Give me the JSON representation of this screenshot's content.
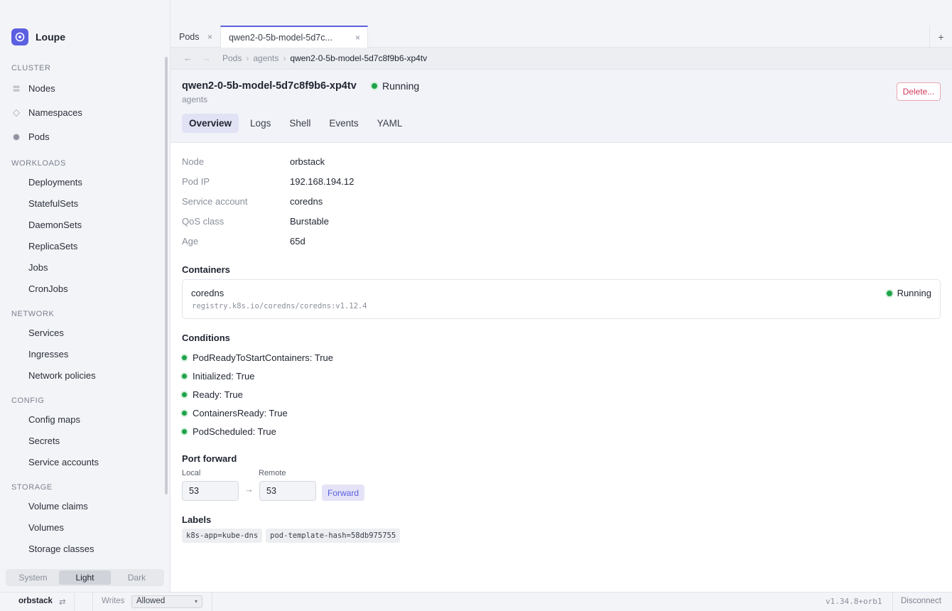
{
  "app": {
    "name": "Loupe",
    "accent": "#5b5fe0"
  },
  "nav": {
    "sections": [
      {
        "title": "CLUSTER",
        "items": [
          {
            "label": "Nodes",
            "icon": "server-icon"
          },
          {
            "label": "Namespaces",
            "icon": "diamond-icon"
          },
          {
            "label": "Pods",
            "icon": "circle-icon"
          }
        ]
      },
      {
        "title": "WORKLOADS",
        "items": [
          {
            "label": "Deployments"
          },
          {
            "label": "StatefulSets"
          },
          {
            "label": "DaemonSets"
          },
          {
            "label": "ReplicaSets"
          },
          {
            "label": "Jobs"
          },
          {
            "label": "CronJobs"
          }
        ]
      },
      {
        "title": "NETWORK",
        "items": [
          {
            "label": "Services"
          },
          {
            "label": "Ingresses"
          },
          {
            "label": "Network policies"
          }
        ]
      },
      {
        "title": "CONFIG",
        "items": [
          {
            "label": "Config maps"
          },
          {
            "label": "Secrets"
          },
          {
            "label": "Service accounts"
          }
        ]
      },
      {
        "title": "STORAGE",
        "items": [
          {
            "label": "Volume claims"
          },
          {
            "label": "Volumes"
          },
          {
            "label": "Storage classes"
          }
        ]
      }
    ]
  },
  "theme": {
    "options": [
      "System",
      "Light",
      "Dark"
    ],
    "selected": "Light"
  },
  "tabs": [
    {
      "label": "Pods",
      "active": false
    },
    {
      "label": "qwen2-0-5b-model-5d7c...",
      "active": true
    }
  ],
  "add_tab_label": "+",
  "breadcrumb": {
    "items": [
      "Pods",
      "agents"
    ],
    "current": "qwen2-0-5b-model-5d7c8f9b6-xp4tv"
  },
  "pod": {
    "name": "qwen2-0-5b-model-5d7c8f9b6-xp4tv",
    "status": "Running",
    "namespace": "agents",
    "status_color": "#1fa34a"
  },
  "delete_label": "Delete...",
  "subtabs": [
    "Overview",
    "Logs",
    "Shell",
    "Events",
    "YAML"
  ],
  "active_subtab": "Overview",
  "details": [
    {
      "key": "Node",
      "value": "orbstack"
    },
    {
      "key": "Pod IP",
      "value": "192.168.194.12"
    },
    {
      "key": "Service account",
      "value": "coredns"
    },
    {
      "key": "QoS class",
      "value": "Burstable"
    },
    {
      "key": "Age",
      "value": "65d"
    }
  ],
  "containers": {
    "title": "Containers",
    "items": [
      {
        "name": "coredns",
        "image": "registry.k8s.io/coredns/coredns:v1.12.4",
        "status": "Running"
      }
    ]
  },
  "conditions": {
    "title": "Conditions",
    "items": [
      "PodReadyToStartContainers: True",
      "Initialized: True",
      "Ready: True",
      "ContainersReady: True",
      "PodScheduled: True"
    ]
  },
  "port_forward": {
    "title": "Port forward",
    "local_label": "Local",
    "remote_label": "Remote",
    "local_value": "53",
    "remote_value": "53",
    "button_label": "Forward"
  },
  "labels": {
    "title": "Labels",
    "items": [
      "k8s-app=kube-dns",
      "pod-template-hash=58db975755"
    ]
  },
  "statusbar": {
    "context": "orbstack",
    "swap_glyph": "⇄",
    "writes_label": "Writes",
    "writes_value": "Allowed",
    "version": "v1.34.8+orb1",
    "disconnect_label": "Disconnect"
  }
}
